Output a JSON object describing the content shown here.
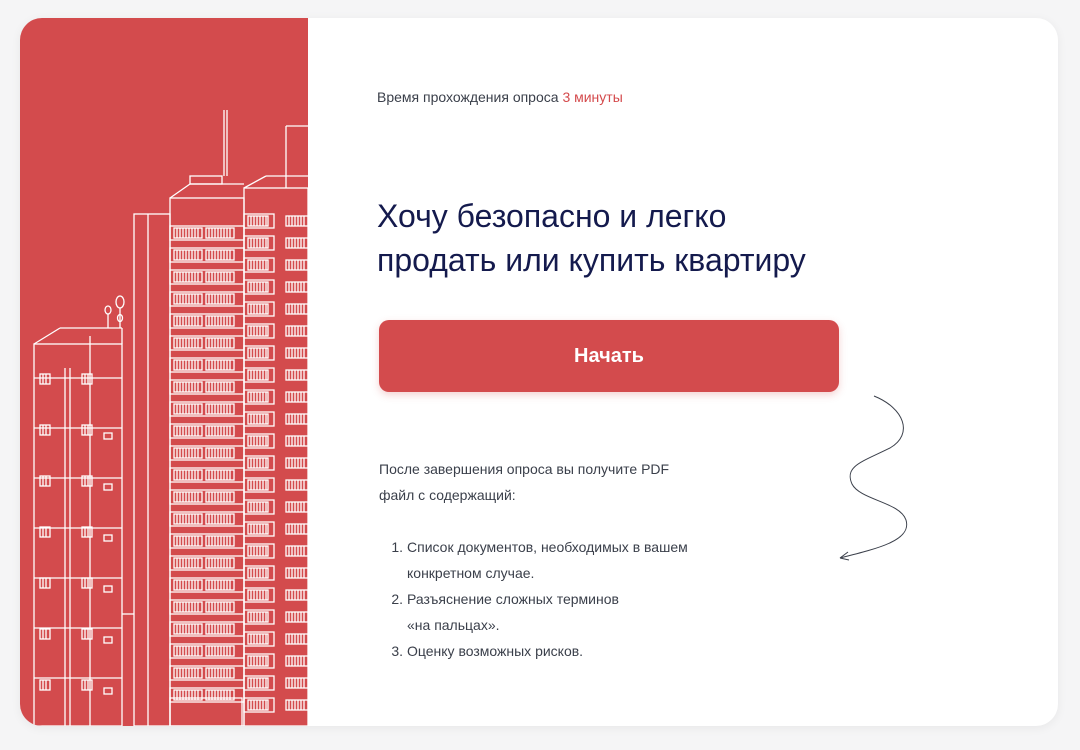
{
  "survey": {
    "duration_label": "Время прохождения опроса",
    "duration_value": "3 минуты"
  },
  "headline": {
    "line1": "Хочу безопасно и легко",
    "line2": "продать или купить квартиру"
  },
  "start_button": {
    "label": "Начать"
  },
  "info": {
    "line1": "После завершения опроса вы получите PDF",
    "line2": "файл с содержащий:"
  },
  "items": [
    {
      "number": "1.",
      "line1": "Список документов, необходимых в вашем",
      "line2": "конкретном случае."
    },
    {
      "number": "2.",
      "line1": "Разъяснение сложных терминов",
      "line2": "«на пальцах»."
    },
    {
      "number": "3.",
      "line1": "Оценку возможных рисков.",
      "line2": ""
    }
  ],
  "illustration": {
    "name": "apartment-building-illustration"
  },
  "decoration": {
    "name": "squiggle-arrow"
  },
  "colors": {
    "accent": "#d34b4d",
    "headline": "#141a4d",
    "body_text": "#3a3f4a",
    "background": "#f5f5f6"
  }
}
